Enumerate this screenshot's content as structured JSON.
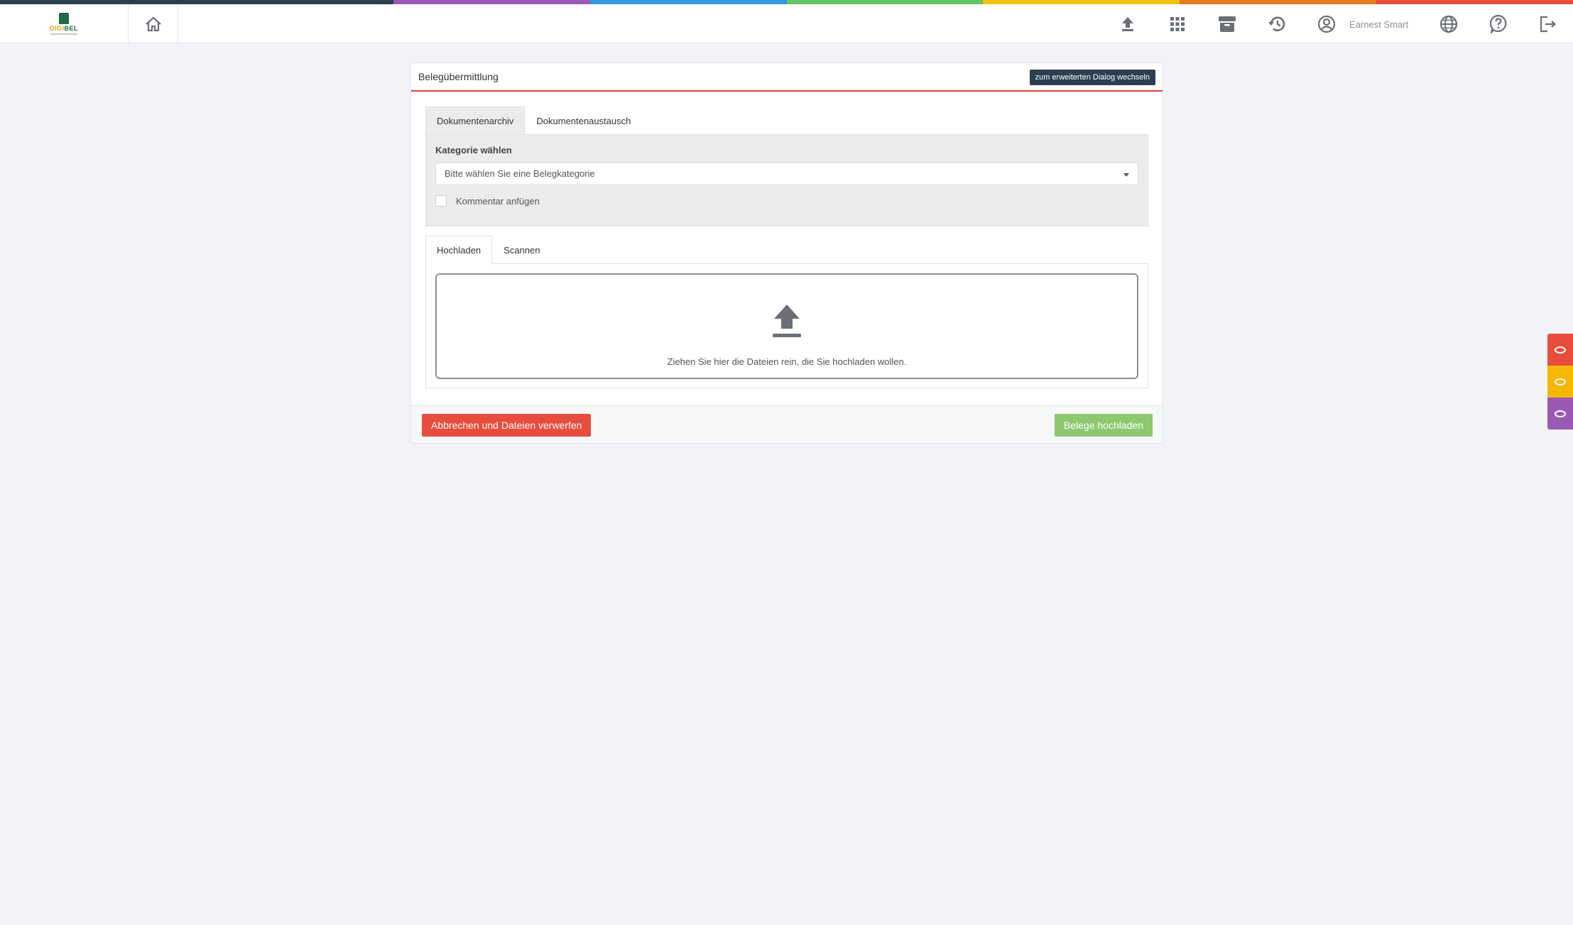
{
  "colors": {
    "rainbow": [
      "#2c3e50",
      "#2c3e50",
      "#9b59b6",
      "#3498db",
      "#62c462",
      "#f1c40f",
      "#e67e22",
      "#e74c3c"
    ],
    "accent_red": "#d9453b",
    "cancel": "#e74c3c",
    "upload": "#8dc96f",
    "side_tabs": [
      "#e74c3c",
      "#f5b700",
      "#9b59b6"
    ]
  },
  "header": {
    "logo_text_a": "DIGI",
    "logo_text_b": "BEL",
    "home_icon": "home-icon",
    "user_name": "Earnest Smart",
    "icons": [
      "upload-icon",
      "apps-grid-icon",
      "archive-icon",
      "history-icon",
      "user-circle-icon",
      "globe-icon",
      "help-icon",
      "logout-icon"
    ]
  },
  "panel": {
    "title": "Belegübermittlung",
    "switch_label": "zum erweiterten Dialog wechseln",
    "tabs": [
      {
        "label": "Dokumentenarchiv"
      },
      {
        "label": "Dokumentenaustausch"
      }
    ],
    "category_label": "Kategorie wählen",
    "category_select": "Bitte wählen Sie eine Belegkategorie",
    "comment_label": "Kommentar anfügen",
    "upload_tabs": [
      {
        "label": "Hochladen"
      },
      {
        "label": "Scannen"
      }
    ],
    "drop_text": "Ziehen Sie hier die Dateien rein, die Sie hochladen wollen.",
    "cancel_label": "Abbrechen und Dateien verwerfen",
    "upload_label": "Belege hochladen"
  },
  "side_tabs": [
    "notes-tab",
    "notes-tab",
    "notes-tab"
  ]
}
